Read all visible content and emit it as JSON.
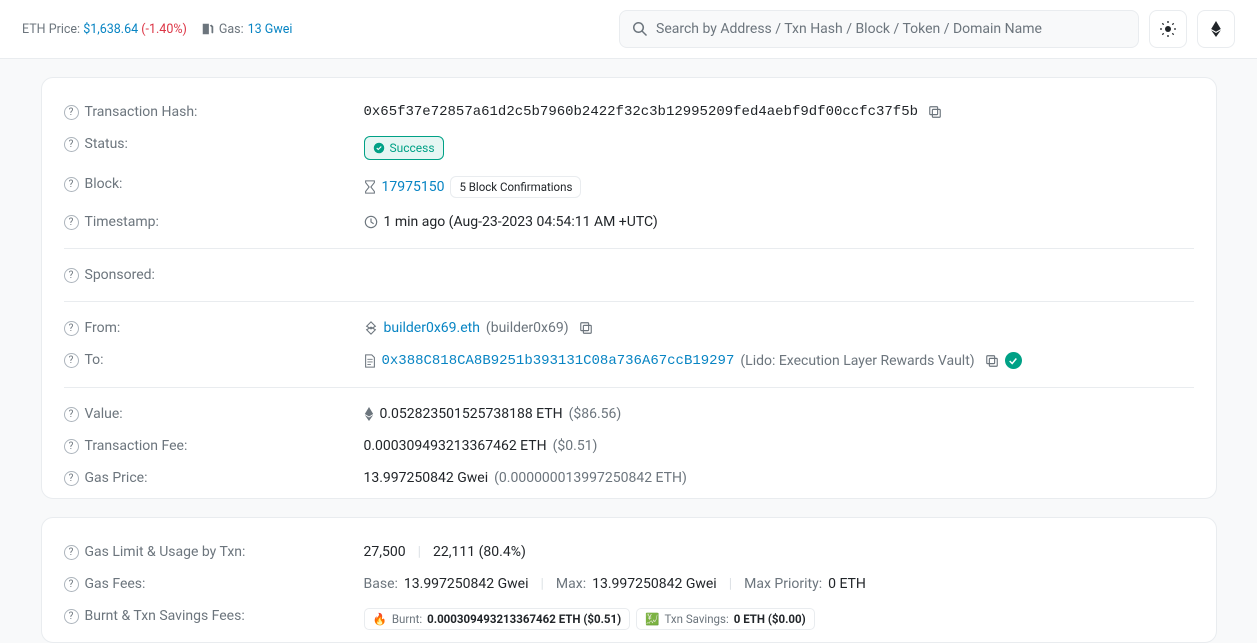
{
  "topbar": {
    "eth_label": "ETH Price:",
    "eth_price": "$1,638.64",
    "eth_change": "(-1.40%)",
    "gas_label": "Gas:",
    "gas_value": "13 Gwei",
    "search_placeholder": "Search by Address / Txn Hash / Block / Token / Domain Name"
  },
  "tx": {
    "hash_label": "Transaction Hash:",
    "hash": "0x65f37e72857a61d2c5b7960b2422f32c3b12995209fed4aebf9df00ccfc37f5b",
    "status_label": "Status:",
    "status_value": "Success",
    "block_label": "Block:",
    "block_number": "17975150",
    "confirmations": "5 Block Confirmations",
    "timestamp_label": "Timestamp:",
    "timestamp_value": "1 min ago (Aug-23-2023 04:54:11 AM +UTC)",
    "sponsored_label": "Sponsored:",
    "from_label": "From:",
    "from_ens": "builder0x69.eth",
    "from_ens_tag": "(builder0x69)",
    "to_label": "To:",
    "to_address": "0x388C818CA8B9251b393131C08a736A67ccB19297",
    "to_tag": "(Lido: Execution Layer Rewards Vault)",
    "value_label": "Value:",
    "value_eth": "0.052823501525738188 ETH",
    "value_usd": "($86.56)",
    "fee_label": "Transaction Fee:",
    "fee_eth": "0.000309493213367462 ETH",
    "fee_usd": "($0.51)",
    "gasprice_label": "Gas Price:",
    "gasprice_gwei": "13.997250842 Gwei",
    "gasprice_eth": "(0.000000013997250842 ETH)"
  },
  "gas": {
    "limit_label": "Gas Limit & Usage by Txn:",
    "limit_value": "27,500",
    "usage_value": "22,111 (80.4%)",
    "fees_label": "Gas Fees:",
    "base_label": "Base:",
    "base_value": "13.997250842 Gwei",
    "max_label": "Max:",
    "max_value": "13.997250842 Gwei",
    "maxprio_label": "Max Priority:",
    "maxprio_value": "0 ETH",
    "burnt_label": "Burnt & Txn Savings Fees:",
    "burnt_tag_label": "Burnt:",
    "burnt_tag_value": "0.000309493213367462 ETH ($0.51)",
    "savings_tag_label": "Txn Savings:",
    "savings_tag_value": "0 ETH ($0.00)"
  }
}
